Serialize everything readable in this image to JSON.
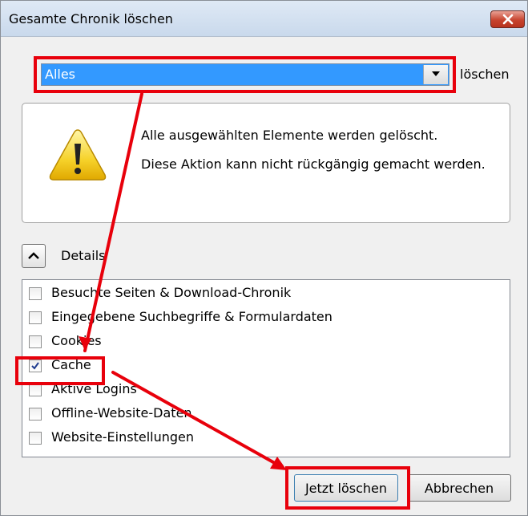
{
  "window": {
    "title": "Gesamte Chronik löschen"
  },
  "timerange": {
    "selected": "Alles",
    "suffix": "löschen"
  },
  "warning": {
    "line1": "Alle ausgewählten Elemente werden gelöscht.",
    "line2": "Diese Aktion kann nicht rückgängig gemacht werden."
  },
  "details": {
    "label": "Details"
  },
  "items": [
    {
      "label": "Besuchte Seiten & Download-Chronik",
      "checked": false
    },
    {
      "label": "Eingegebene Suchbegriffe & Formulardaten",
      "checked": false
    },
    {
      "label": "Cookies",
      "checked": false
    },
    {
      "label": "Cache",
      "checked": true
    },
    {
      "label": "Aktive Logins",
      "checked": false
    },
    {
      "label": "Offline-Website-Daten",
      "checked": false
    },
    {
      "label": "Website-Einstellungen",
      "checked": false
    }
  ],
  "buttons": {
    "clear": "Jetzt löschen",
    "cancel": "Abbrechen"
  },
  "colors": {
    "highlight": "#e8000b",
    "selection": "#3399ff"
  },
  "icons": {
    "warning": "warning-triangle-icon",
    "close": "close-x-icon",
    "dropdown": "chevron-down-icon",
    "toggle": "chevron-up-icon"
  }
}
